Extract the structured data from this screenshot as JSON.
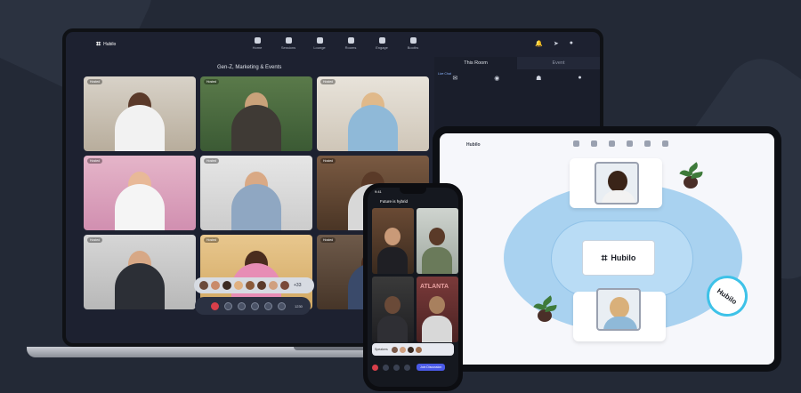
{
  "laptop": {
    "brand": "Hubilo",
    "nav": [
      {
        "label": "Home"
      },
      {
        "label": "Sessions"
      },
      {
        "label": "Lounge"
      },
      {
        "label": "Rooms"
      },
      {
        "label": "Engage"
      },
      {
        "label": "Booths"
      }
    ],
    "stage_title": "Gen-Z, Marketing & Events",
    "side_tabs": [
      "This Room",
      "Event"
    ],
    "livechat_label": "Live Chat",
    "reaction_more": "+33",
    "controls_count": "1230",
    "tile_tags": [
      "Hosted",
      "Hosted",
      "Hosted",
      "Hosted",
      "Hosted",
      "Hosted",
      "Hosted",
      "Hosted",
      "Hosted"
    ]
  },
  "phone": {
    "time": "9:41",
    "title": "Future is hybrid",
    "sign_text": "ATLANTA",
    "speakers_label": "Speakers",
    "join_label": "Join Discussion"
  },
  "tablet": {
    "brand": "Hubilo",
    "center_logo": "Hubilo",
    "badge_logo": "Hubilo"
  },
  "colors": {
    "background": "#232936",
    "laptop_screen": "#1d2130",
    "lounge": "#a9d2f0",
    "accent": "#4a5ae8",
    "leave": "#d93f4a"
  }
}
